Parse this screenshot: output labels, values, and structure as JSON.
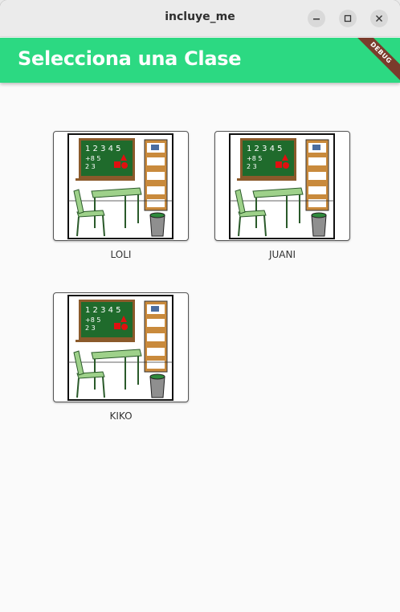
{
  "window": {
    "title": "incluye_me"
  },
  "appbar": {
    "title": "Selecciona una Clase",
    "debug_banner": "DEBUG",
    "color": "#2cd982"
  },
  "classes": [
    {
      "label": "LOLI"
    },
    {
      "label": "JUANI"
    },
    {
      "label": "KIKO"
    }
  ],
  "classroom_image": {
    "board_text_1": "1 2 3 4 5",
    "board_text_2": "+8 5",
    "board_text_3": "2 3"
  }
}
